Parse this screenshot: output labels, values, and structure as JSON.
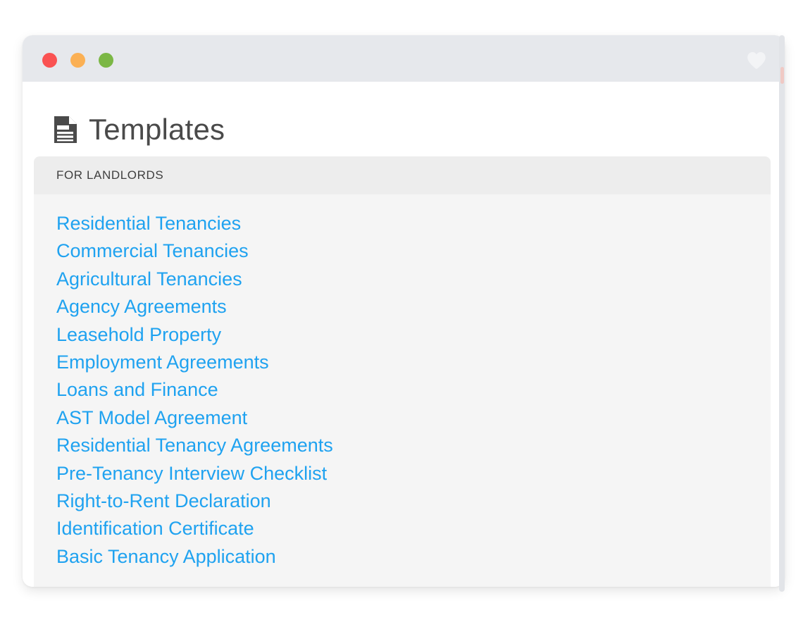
{
  "window": {
    "controls": [
      {
        "name": "close",
        "color": "#fa5252"
      },
      {
        "name": "minimize",
        "color": "#fbb054"
      },
      {
        "name": "maximize",
        "color": "#7bb745"
      }
    ],
    "favorite_icon": "heart-icon",
    "favorite_color": "#f3f4f6"
  },
  "header": {
    "icon": "document-icon",
    "title": "Templates",
    "title_color": "#4a4a4a"
  },
  "card": {
    "section_label": "FOR LANDLORDS",
    "link_color": "#1fa2f0",
    "items": [
      {
        "label": "Residential Tenancies"
      },
      {
        "label": "Commercial Tenancies"
      },
      {
        "label": "Agricultural Tenancies"
      },
      {
        "label": "Agency Agreements"
      },
      {
        "label": "Leasehold Property"
      },
      {
        "label": "Employment Agreements"
      },
      {
        "label": "Loans and Finance"
      },
      {
        "label": "AST Model Agreement"
      },
      {
        "label": "Residential Tenancy Agreements"
      },
      {
        "label": "Pre-Tenancy Interview Checklist"
      },
      {
        "label": "Right-to-Rent Declaration"
      },
      {
        "label": "Identification Certificate"
      },
      {
        "label": "Basic Tenancy Application"
      }
    ]
  },
  "scrollbar": {
    "track_color": "#e2e4e8",
    "thumb_color": "#f0c9c4"
  }
}
